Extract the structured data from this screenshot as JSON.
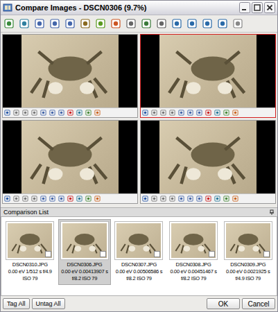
{
  "window": {
    "title": "Compare Images - DSCN0306 (9.7%)"
  },
  "panes": [
    {
      "selected": false
    },
    {
      "selected": true
    },
    {
      "selected": false
    },
    {
      "selected": false
    }
  ],
  "comparison_list": {
    "title": "Comparison List",
    "items": [
      {
        "lines": [
          "DSCN0310.JPG",
          "0.00 eV 1/512 s f/4.9",
          "ISO 79"
        ],
        "selected": false,
        "tagged": false
      },
      {
        "lines": [
          "DSCN0306.JPG",
          "0.00 eV 0.00413907 s",
          "f/8.2 ISO 79"
        ],
        "selected": true,
        "tagged": false
      },
      {
        "lines": [
          "DSCN0307.JPG",
          "0.00 eV 0.00506586 s",
          "f/8.2 ISO 79"
        ],
        "selected": false,
        "tagged": false
      },
      {
        "lines": [
          "DSCN0308.JPG",
          "0.00 eV 0.00451467 s",
          "f/8.2 ISO 79"
        ],
        "selected": false,
        "tagged": false
      },
      {
        "lines": [
          "DSCN0309.JPG",
          "0.00 eV 0.0021925 s",
          "f/4.9 ISO 79"
        ],
        "selected": false,
        "tagged": false
      }
    ]
  },
  "buttons_left": [
    "Tag All",
    "Untag All"
  ],
  "buttons_right": [
    "OK",
    "Cancel"
  ]
}
